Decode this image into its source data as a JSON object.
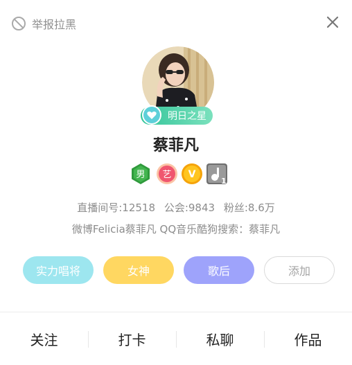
{
  "header": {
    "report_label": "举报拉黑"
  },
  "profile": {
    "rank_badge": "明日之星",
    "name": "蔡菲凡",
    "badges": [
      {
        "icon": "gender-male-badge",
        "text": "男",
        "color": "#2f9a3c"
      },
      {
        "icon": "art-badge",
        "text": "艺",
        "color": "#f0566f"
      },
      {
        "icon": "vip-badge",
        "text": "V",
        "color": "#f5a30a"
      },
      {
        "icon": "music-level-badge",
        "text": "1",
        "color": "#6f6f6f"
      }
    ],
    "stats": {
      "room_id_label": "直播间号:12518",
      "guild_label": "公会:9843",
      "fans_label": "粉丝:8.6万"
    },
    "bio": "微博Felicia蔡菲凡 QQ音乐酷狗搜索：蔡菲凡"
  },
  "tags": {
    "items": [
      "实力唱将",
      "女神",
      "歌后"
    ],
    "colors": [
      "#9de6ef",
      "#ffd761",
      "#9ea3fb"
    ],
    "add_label": "添加"
  },
  "actions": [
    "关注",
    "打卡",
    "私聊",
    "作品"
  ]
}
